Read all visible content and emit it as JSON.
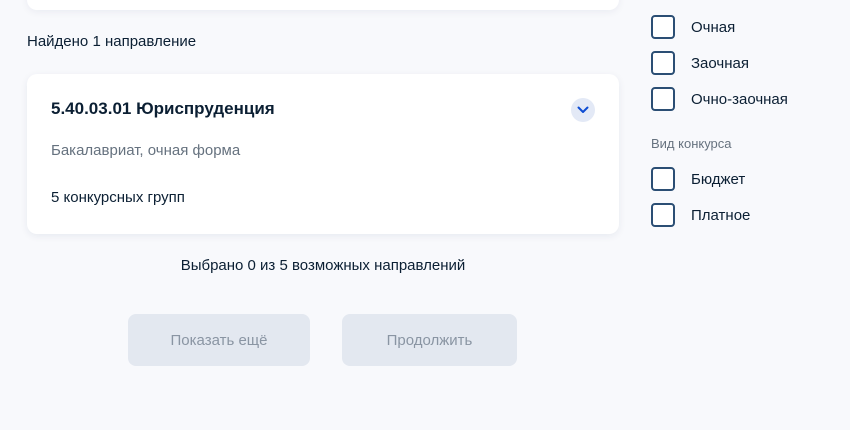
{
  "results": {
    "found_text": "Найдено 1 направление",
    "direction": {
      "title": "5.40.03.01 Юриспруденция",
      "subtitle": "Бакалавриат, очная форма",
      "groups": "5 конкурсных групп"
    },
    "selected_text": "Выбрано 0 из 5 возможных направлений"
  },
  "actions": {
    "show_more_label": "Показать ещё",
    "continue_label": "Продолжить"
  },
  "filters": {
    "study_form": [
      {
        "label": "Очная",
        "checked": false
      },
      {
        "label": "Заочная",
        "checked": false
      },
      {
        "label": "Очно-заочная",
        "checked": false
      }
    ],
    "competition_title": "Вид конкурса",
    "competition": [
      {
        "label": "Бюджет",
        "checked": false
      },
      {
        "label": "Платное",
        "checked": false
      }
    ]
  },
  "colors": {
    "background": "#f8f9fc",
    "card": "#ffffff",
    "checkbox_border": "#2b4e74",
    "disabled_button": "#e3e8f0",
    "chevron_bg": "#e3e9f6",
    "chevron_icon": "#0d4cd3"
  },
  "icons": {
    "expand": "chevron-down-icon"
  }
}
